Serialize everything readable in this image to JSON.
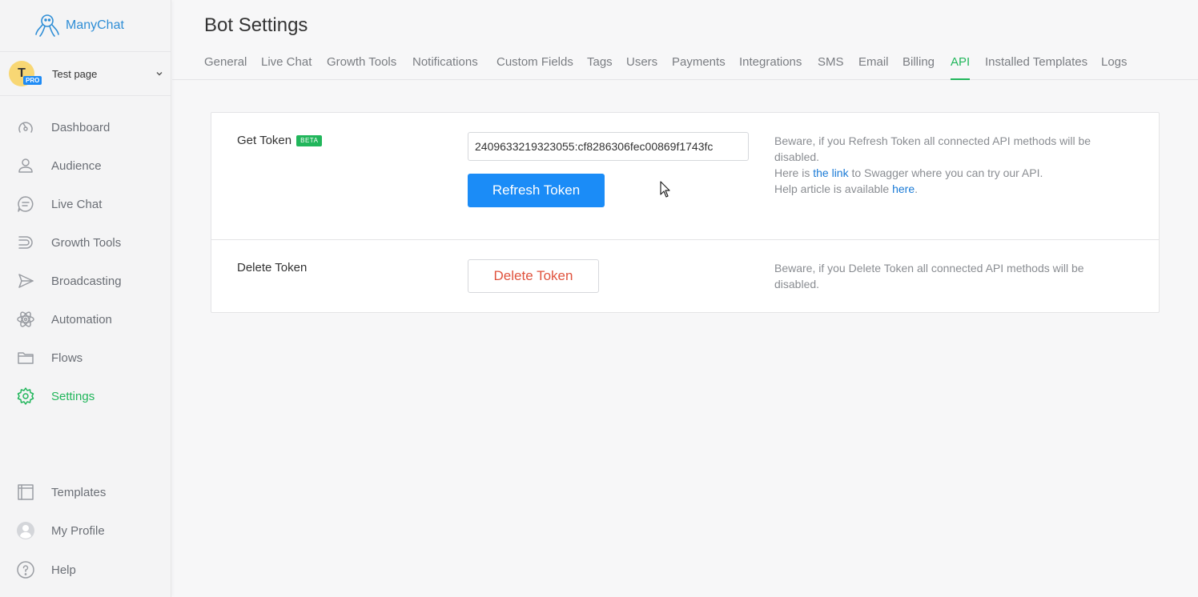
{
  "brand": {
    "name": "ManyChat",
    "color": "#2f8ed6"
  },
  "account": {
    "avatar_letter": "T",
    "badge": "PRO",
    "page_name": "Test page"
  },
  "sidebar": {
    "items": [
      {
        "label": "Dashboard",
        "icon": "dashboard-icon"
      },
      {
        "label": "Audience",
        "icon": "user-icon"
      },
      {
        "label": "Live Chat",
        "icon": "chat-bubble-icon"
      },
      {
        "label": "Growth Tools",
        "icon": "magnet-icon"
      },
      {
        "label": "Broadcasting",
        "icon": "send-icon"
      },
      {
        "label": "Automation",
        "icon": "atom-icon"
      },
      {
        "label": "Flows",
        "icon": "folder-icon"
      },
      {
        "label": "Settings",
        "icon": "gear-icon",
        "active": true
      }
    ],
    "bottom_items": [
      {
        "label": "Templates",
        "icon": "templates-icon"
      },
      {
        "label": "My Profile",
        "icon": "profile-icon"
      },
      {
        "label": "Help",
        "icon": "help-icon"
      }
    ]
  },
  "header": {
    "title": "Bot Settings",
    "tabs": [
      "General",
      "Live Chat",
      "Growth Tools",
      "Notifications",
      "Custom Fields",
      "Tags",
      "Users",
      "Payments",
      "Integrations",
      "SMS",
      "Email",
      "Billing",
      "API",
      "Installed Templates",
      "Logs"
    ],
    "active_tab": "API"
  },
  "api": {
    "get_token": {
      "label": "Get Token",
      "badge": "BETA",
      "token_value": "2409633219323055:cf8286306fec00869f1743fc",
      "refresh_button": "Refresh Token",
      "note_line1": "Beware, if you Refresh Token all connected API methods will be disabled.",
      "note_line2_prefix": "Here is ",
      "note_line2_link": "the link",
      "note_line2_suffix": " to Swagger where you can try our API.",
      "note_line3_prefix": "Help article is available ",
      "note_line3_link": "here",
      "note_line3_suffix": "."
    },
    "delete_token": {
      "label": "Delete Token",
      "button": "Delete Token",
      "note": "Beware, if you Delete Token all connected API methods will be disabled."
    }
  },
  "colors": {
    "accent_green": "#21b65b",
    "primary_blue": "#1b8cf7",
    "danger_red": "#e0533e"
  }
}
